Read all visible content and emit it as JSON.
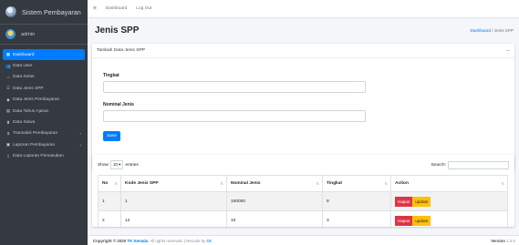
{
  "brand": {
    "title": "Sistem Pembayaran"
  },
  "user": {
    "name": "admin"
  },
  "sidebar": {
    "items": [
      {
        "label": "Dashboard",
        "icon": "dashboard-icon",
        "active": true
      },
      {
        "label": "Data User",
        "icon": "users-icon"
      },
      {
        "label": "Data Kelas",
        "icon": "class-icon"
      },
      {
        "label": "Data Jenis SPP",
        "icon": "list-icon"
      },
      {
        "label": "Data Jenis Pembayaran",
        "icon": "payment-icon"
      },
      {
        "label": "Data Tahun Ajaran",
        "icon": "calendar-icon"
      },
      {
        "label": "Data Siswa",
        "icon": "student-icon"
      },
      {
        "label": "Transaksi Pembayaran",
        "icon": "dollar-icon",
        "arrow": true
      },
      {
        "label": "Laporan Pembayaran",
        "icon": "report-icon",
        "arrow": true
      },
      {
        "label": "Data Laporan Pemasukan",
        "icon": "income-icon"
      }
    ]
  },
  "topbar": {
    "links": [
      "Dashboard",
      "Log Out"
    ]
  },
  "page": {
    "title": "Jenis SPP",
    "breadcrumb": {
      "home": "Dashboard",
      "separator": "/",
      "current": "Jenis SPP"
    }
  },
  "form": {
    "card_title": "Tambah Data Jenis SPP",
    "collapse_symbol": "–",
    "tingkat_label": "Tingkat",
    "tingkat_value": "",
    "nominal_label": "Nominal Jenis",
    "nominal_value": "",
    "save_label": "Save"
  },
  "table": {
    "show_prefix": "Show",
    "entries_value": "10",
    "show_suffix": "entries",
    "search_label": "Search:",
    "search_value": "",
    "columns": [
      "No",
      "Kode Jenis SPP",
      "Nominal Jenis",
      "Tingkat",
      "Action"
    ],
    "rows": [
      {
        "no": "1",
        "kode": "1",
        "nominal": "150000",
        "tingkat": "8"
      },
      {
        "no": "2",
        "kode": "12",
        "nominal": "10",
        "tingkat": "3"
      }
    ],
    "hapus_label": "Hapus",
    "update_label": "update"
  },
  "footer": {
    "prefix": "Copyright © 2020",
    "brand": "TK Kemala",
    "rights": ". All rights reserved. | Recode by",
    "recode": "Dk",
    "version_label": "Version",
    "version_value": "1.0.0"
  },
  "colors": {
    "primary": "#007bff",
    "sidebar": "#343a40",
    "danger": "#dc3545",
    "warning": "#ffc107"
  }
}
